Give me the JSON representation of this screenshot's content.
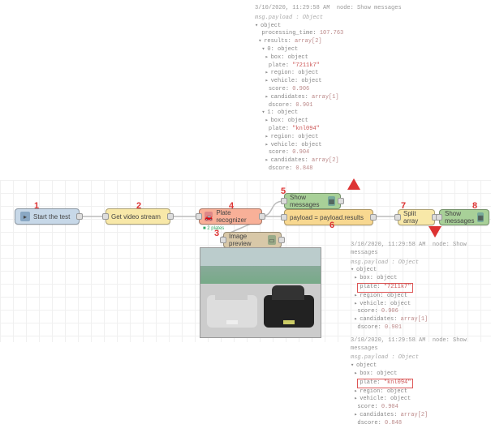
{
  "meta": {
    "timestamp": "3/10/2020, 11:29:58 AM",
    "node_label": "node: Show messages",
    "payload_label": "msg.payload : Object"
  },
  "numlabels": {
    "n1": "1",
    "n2": "2",
    "n3": "3",
    "n4": "4",
    "n5": "5",
    "n6": "6",
    "n7": "7",
    "n8": "8"
  },
  "nodes": {
    "inject": "Start the test",
    "http": "Get video stream",
    "plate": "Plate recognizer",
    "plate_status": "2 plates",
    "payload": "payload = payload.results",
    "split": "Split array",
    "debug1": "Show messages",
    "debug2": "Show messages",
    "img": "Image preview"
  },
  "tree_top": {
    "object": "object",
    "processing_time_k": "processing_time:",
    "processing_time_v": "107.763",
    "results_k": "results:",
    "results_t": "array[2]",
    "idx0": "0:",
    "idx1": "1:",
    "box_k": "box:",
    "plate_k": "plate:",
    "plate0_v": "\"7211k7\"",
    "plate1_v": "\"knl094\"",
    "region_k": "region:",
    "vehicle_k": "vehicle:",
    "score_k": "score:",
    "score0_v": "0.906",
    "score1_v": "0.904",
    "candidates_k": "candidates:",
    "cand0_t": "array[1]",
    "cand1_t": "array[2]",
    "dscore_k": "dscore:",
    "dscore0_v": "0.901",
    "dscore1_v": "0.848",
    "obj_t": "object"
  },
  "tree_bot": {
    "plate0_v": "\"7211k7\"",
    "plate1_v": "\"knl094\"",
    "score0_v": "0.906",
    "score1_v": "0.904",
    "dscore0_v": "0.901",
    "dscore1_v": "0.848",
    "cand0_t": "array[1]",
    "cand1_t": "array[2]"
  }
}
